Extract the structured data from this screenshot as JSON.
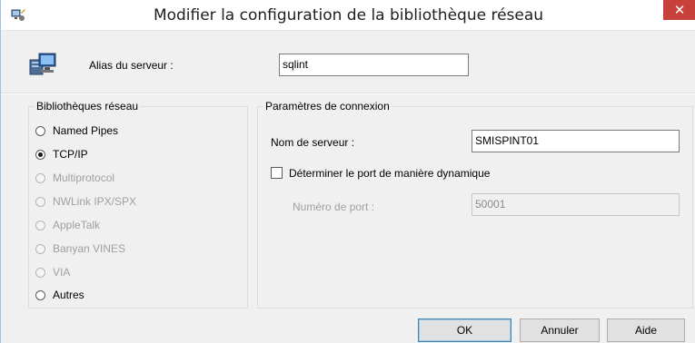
{
  "window": {
    "title": "Modifier la configuration de la bibliothèque réseau",
    "close_glyph": "✕",
    "icon": "network-config-icon"
  },
  "alias": {
    "label": "Alias du serveur :",
    "value": "sqlint",
    "icon": "computer-network-icon"
  },
  "libraries": {
    "legend": "Bibliothèques réseau",
    "options": [
      {
        "label": "Named Pipes",
        "checked": false,
        "enabled": true
      },
      {
        "label": "TCP/IP",
        "checked": true,
        "enabled": true
      },
      {
        "label": "Multiprotocol",
        "checked": false,
        "enabled": false
      },
      {
        "label": "NWLink IPX/SPX",
        "checked": false,
        "enabled": false
      },
      {
        "label": "AppleTalk",
        "checked": false,
        "enabled": false
      },
      {
        "label": "Banyan VINES",
        "checked": false,
        "enabled": false
      },
      {
        "label": "VIA",
        "checked": false,
        "enabled": false
      },
      {
        "label": "Autres",
        "checked": false,
        "enabled": true
      }
    ]
  },
  "connection": {
    "legend": "Paramètres de connexion",
    "server_name_label": "Nom de serveur :",
    "server_name_value": "SMISPINT01",
    "dynamic_port_label": "Déterminer le port de manière dynamique",
    "dynamic_port_checked": false,
    "port_label": "Numéro de port :",
    "port_value": "50001"
  },
  "buttons": {
    "ok": "OK",
    "cancel": "Annuler",
    "help": "Aide"
  },
  "colors": {
    "close_button": "#c7413a",
    "accent_border": "#9ec1e4"
  }
}
